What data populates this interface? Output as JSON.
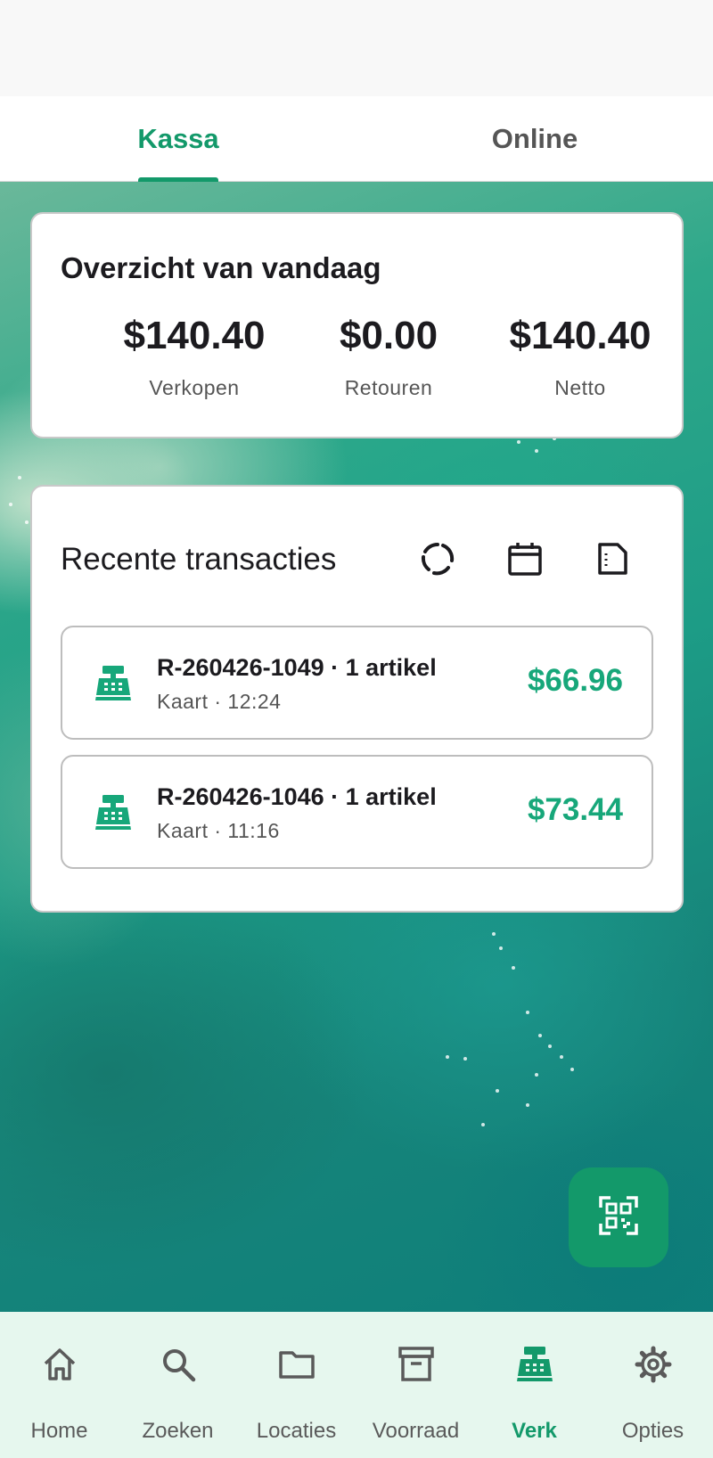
{
  "tabs": [
    {
      "label": "Kassa",
      "active": true
    },
    {
      "label": "Online",
      "active": false
    }
  ],
  "summary": {
    "title": "Overzicht van vandaag",
    "metrics": [
      {
        "value": "$140.40",
        "label": "Verkopen"
      },
      {
        "value": "$0.00",
        "label": "Retouren"
      },
      {
        "value": "$140.40",
        "label": "Netto"
      }
    ]
  },
  "recent": {
    "title": "Recente transacties",
    "actions": [
      {
        "icon": "refresh-icon"
      },
      {
        "icon": "calendar-icon"
      },
      {
        "icon": "export-icon"
      }
    ],
    "transactions": [
      {
        "title": "R-260426-1049 · 1 artikel",
        "subtitle": "Kaart · 12:24",
        "amount": "$66.96",
        "icon": "cash-register-icon"
      },
      {
        "title": "R-260426-1046 · 1 artikel",
        "subtitle": "Kaart · 11:16",
        "amount": "$73.44",
        "icon": "cash-register-icon"
      }
    ]
  },
  "fab": {
    "icon": "qr-scan-icon"
  },
  "nav": {
    "items": [
      {
        "label": "Home",
        "icon": "home-icon",
        "active": false
      },
      {
        "label": "Zoeken",
        "icon": "search-icon",
        "active": false
      },
      {
        "label": "Locaties",
        "icon": "folder-icon",
        "active": false
      },
      {
        "label": "Voorraad",
        "icon": "archive-icon",
        "active": false
      },
      {
        "label": "Verk",
        "icon": "cash-register-icon",
        "active": true
      },
      {
        "label": "Opties",
        "icon": "gear-icon",
        "active": false
      }
    ]
  },
  "colors": {
    "accent": "#13996a",
    "amount": "#17a77a",
    "nav_background": "#e6f7ee"
  }
}
